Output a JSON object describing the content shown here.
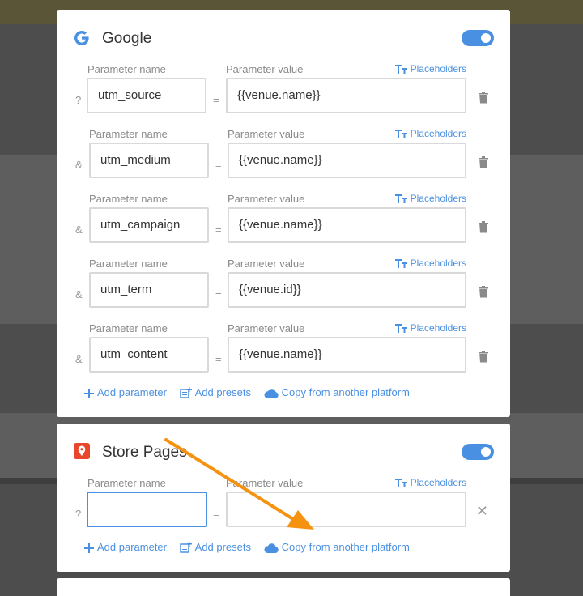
{
  "labels": {
    "param_name": "Parameter name",
    "param_value": "Parameter value",
    "placeholders": "Placeholders",
    "equals": "=",
    "add_parameter": "Add parameter",
    "add_presets": "Add presets",
    "copy_platform": "Copy from another platform"
  },
  "google": {
    "title": "Google",
    "enabled": true,
    "params": [
      {
        "sep": "?",
        "name": "utm_source",
        "value": "{{venue.name}}"
      },
      {
        "sep": "&",
        "name": "utm_medium",
        "value": "{{venue.name}}"
      },
      {
        "sep": "&",
        "name": "utm_campaign",
        "value": "{{venue.name}}"
      },
      {
        "sep": "&",
        "name": "utm_term",
        "value": "{{venue.id}}"
      },
      {
        "sep": "&",
        "name": "utm_content",
        "value": "{{venue.name}}"
      }
    ]
  },
  "store_pages": {
    "title": "Store Pages",
    "enabled": true,
    "params": [
      {
        "sep": "?",
        "name": "",
        "value": ""
      }
    ]
  },
  "colors": {
    "accent": "#4a90e2",
    "annotation_arrow": "#f5920f",
    "store_icon": "#e8472b"
  }
}
